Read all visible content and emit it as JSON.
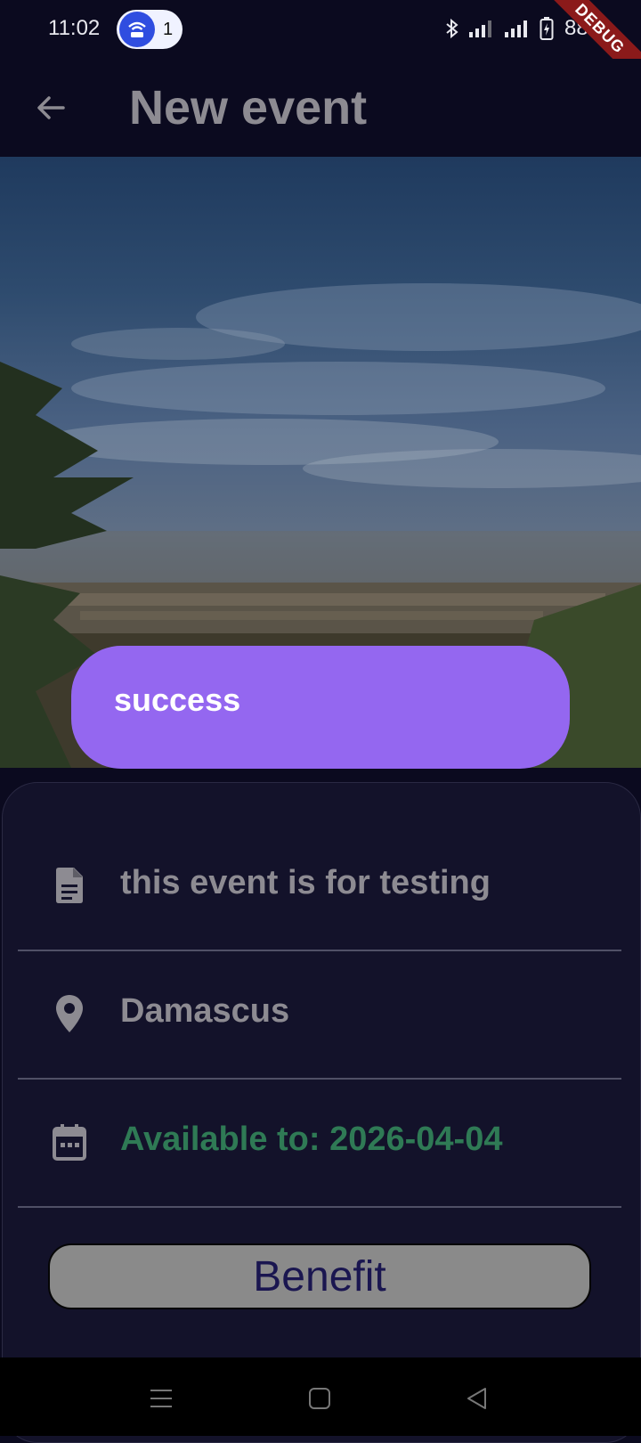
{
  "status_bar": {
    "time": "11:02",
    "hotspot_count": "1",
    "battery": "88%",
    "debug_label": "DEBUG"
  },
  "app_bar": {
    "title": "New event",
    "back_icon": "arrow-left-icon"
  },
  "snackbar": {
    "message": "success"
  },
  "details": {
    "description": "this event is for testing",
    "location": "Damascus",
    "availability": "Available to: 2026-04-04"
  },
  "actions": {
    "benefit_label": "Benefit"
  },
  "colors": {
    "background": "#0b0a1f",
    "card": "#13122a",
    "snackbar": "#9467f0",
    "availability_text": "#2f7a55",
    "button": "#8a8a8a"
  }
}
